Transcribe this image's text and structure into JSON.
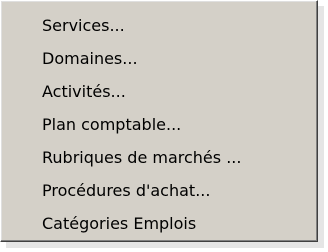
{
  "menu": {
    "items": [
      {
        "label": "Services..."
      },
      {
        "label": "Domaines..."
      },
      {
        "label": "Activités..."
      },
      {
        "label": "Plan comptable..."
      },
      {
        "label": "Rubriques de marchés ..."
      },
      {
        "label": "Procédures d'achat..."
      },
      {
        "label": "Catégories Emplois"
      }
    ]
  }
}
